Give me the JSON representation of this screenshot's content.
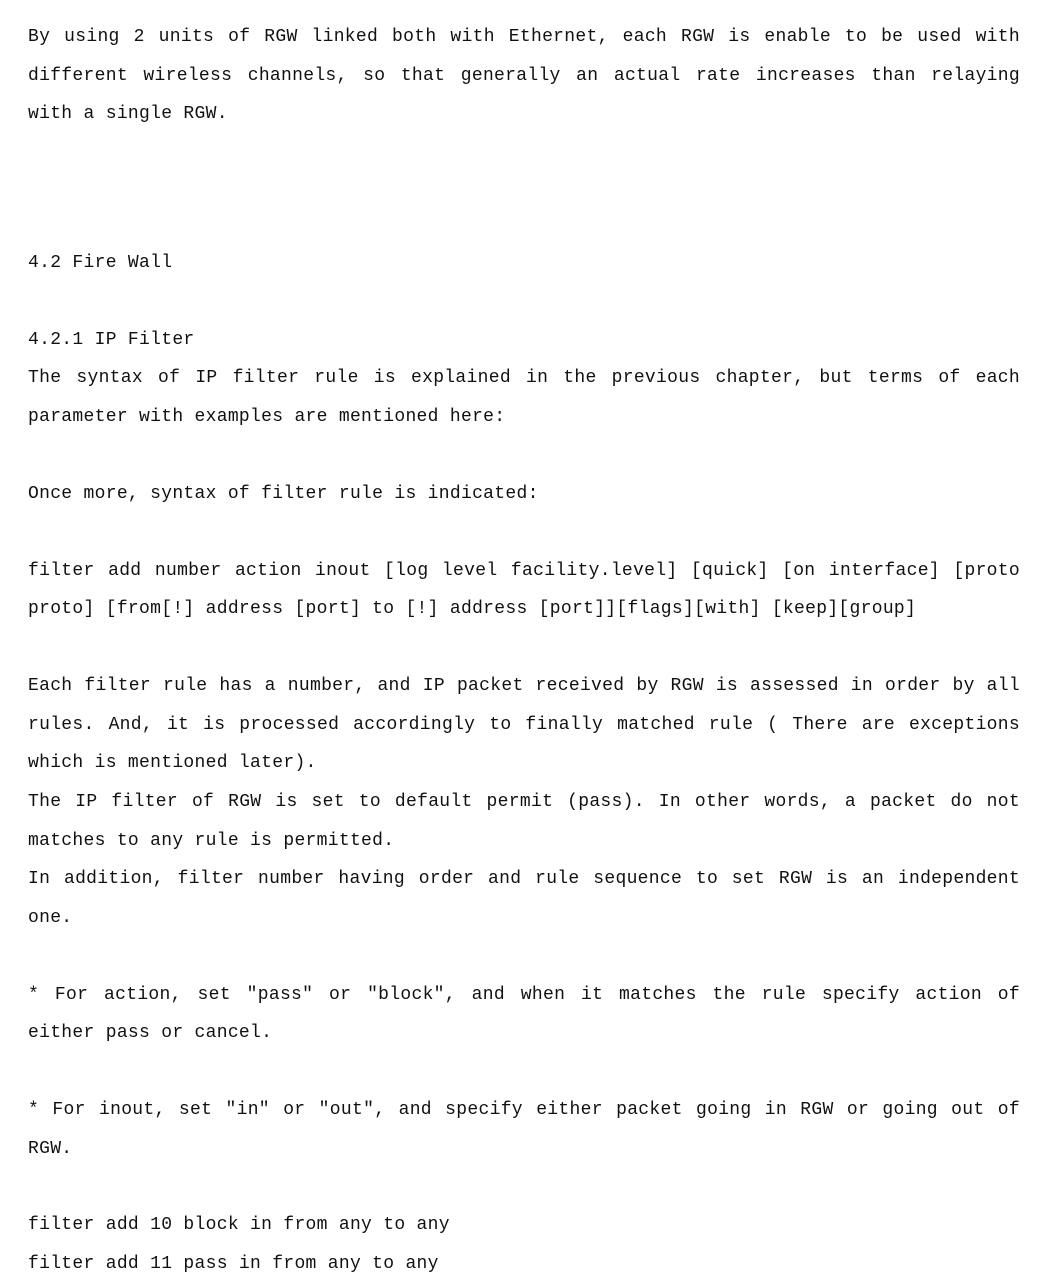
{
  "p1": "By using 2 units of RGW linked both with Ethernet, each RGW is enable to be used with different wireless channels, so that generally an actual rate increases than relaying with a single RGW.",
  "h2": "4.2 Fire Wall",
  "h3": "4.2.1 IP Filter",
  "p2": "The syntax of IP filter rule is explained in the previous chapter, but terms of each parameter with examples are mentioned here:",
  "p3": "Once more, syntax of filter rule is indicated:",
  "syntax1": "filter add  number action inout [log level facility.level] [quick] [on interface] [proto proto] [from[!] address [port] to [!] address [port]][flags][with] [keep][group]",
  "p4": "Each filter rule has a number, and IP packet received by RGW is assessed in order by all rules. And, it is processed accordingly to finally matched rule ( There are exceptions which is mentioned later).",
  "p5": "The IP filter of RGW is set to default permit (pass). In other words, a packet do not matches to any rule is permitted.",
  "p6": "In addition, filter number having order and rule sequence to set RGW is an independent one.",
  "p7": "* For action, set \"pass\" or \"block\", and when it matches the rule specify action of either pass or cancel.",
  "p8": "* For inout, set \"in\" or \"out\", and specify either packet going in RGW or going out of RGW.",
  "cmd1": "filter add 10 block in from any to any",
  "cmd2": "filter add 11 pass in from any to any"
}
